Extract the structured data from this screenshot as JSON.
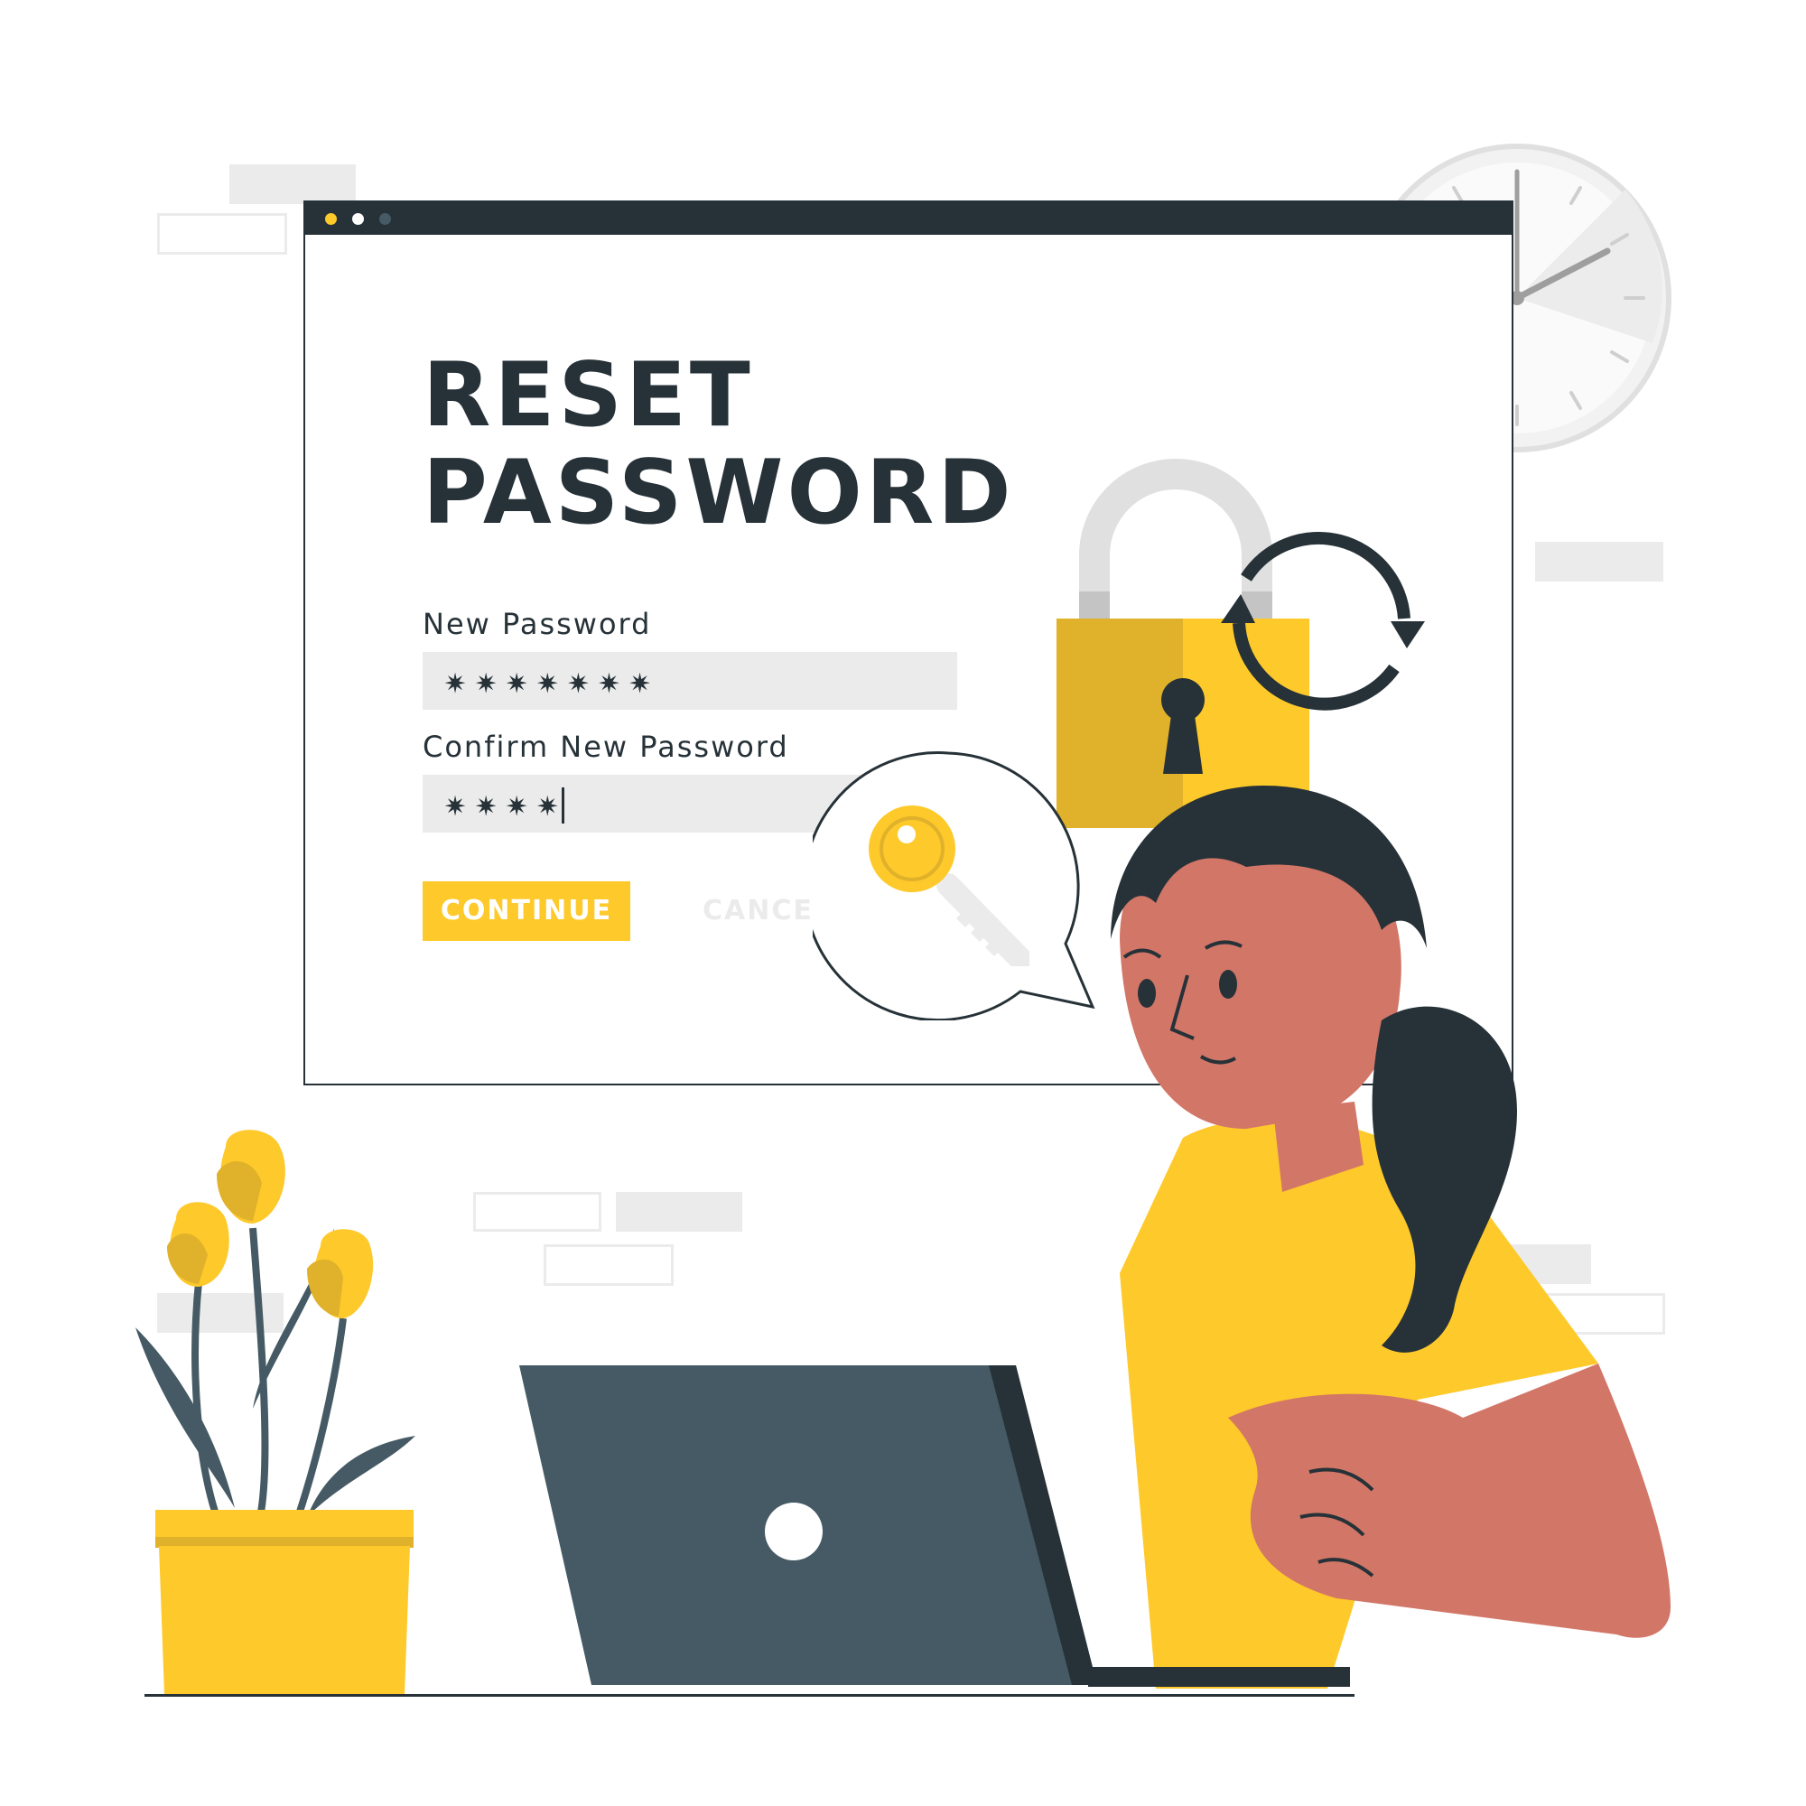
{
  "colors": {
    "accent_yellow": "#fec92a",
    "dark_yellow": "#e0b12a",
    "dark": "#263238",
    "slate": "#455a64",
    "light_grey": "#ebebeb",
    "skin": "#d27667",
    "white": "#ffffff"
  },
  "window": {
    "dots": [
      "#fec92a",
      "#ffffff",
      "#455a64"
    ]
  },
  "form": {
    "title": "RESET\nPASSWORD",
    "new_password_label": "New Password",
    "new_password_value": "✷✷✷✷✷✷✷",
    "confirm_password_label": "Confirm New Password",
    "confirm_password_value": "✷✷✷✷",
    "continue_label": "CONTINUE",
    "cancel_label": "CANCEL"
  },
  "icons": {
    "padlock": "lock-icon",
    "refresh": "refresh-icon",
    "key": "key-icon",
    "clock": "clock-icon"
  }
}
